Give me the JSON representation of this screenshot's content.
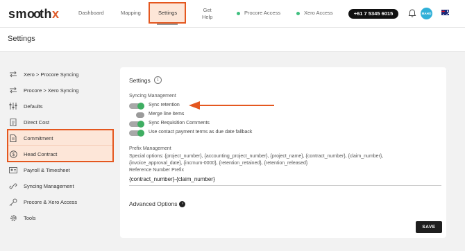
{
  "brand": {
    "logo_prefix": "sm",
    "logo_mid": "◯◯",
    "logo_th": "th",
    "logo_x": "x"
  },
  "nav": {
    "dashboard": "Dashboard",
    "mapping": "Mapping",
    "settings": "Settings",
    "help_line1": "Get",
    "help_line2": "Help",
    "procore_access": "Procore Access",
    "xero_access": "Xero Access",
    "phone": "+61 7 5345 6015",
    "avatar_text": "MAHO",
    "status_color": "#3fbf7f",
    "accent": "#e4571f"
  },
  "page": {
    "title": "Settings"
  },
  "sidebar": {
    "items": [
      {
        "label": "Xero > Procore Syncing",
        "icon": "arrows-swap-icon"
      },
      {
        "label": "Procore > Xero Syncing",
        "icon": "arrows-swap-icon"
      },
      {
        "label": "Defaults",
        "icon": "sliders-icon"
      },
      {
        "label": "Direct Cost",
        "icon": "document-icon"
      },
      {
        "label": "Commitment",
        "icon": "file-icon"
      },
      {
        "label": "Head Contract",
        "icon": "dollar-icon"
      },
      {
        "label": "Payroll & Timesheet",
        "icon": "id-card-icon"
      },
      {
        "label": "Syncing Management",
        "icon": "link-icon"
      },
      {
        "label": "Procore & Xero Access",
        "icon": "key-icon"
      },
      {
        "label": "Tools",
        "icon": "gear-icon"
      }
    ]
  },
  "settings": {
    "title": "Settings",
    "info_glyph": "i",
    "syncing_heading": "Syncing Management",
    "toggles": [
      {
        "label": "Sync retention",
        "on": true
      },
      {
        "label": "Merge line items",
        "on": false
      },
      {
        "label": "Sync Requisition Comments",
        "on": true
      },
      {
        "label": "Use contact payment terms as due date fallback",
        "on": true
      }
    ],
    "prefix_heading": "Prefix Management",
    "special_options": "Special options: {project_number}, {accounting_project_number}, {project_name}, {contract_number}, {claim_number}, {invoice_approval_date}, {incmum-0000}, {retention_retained}, {retention_released}",
    "ref_prefix_label": "Reference Number Prefix",
    "ref_prefix_value": "{contract_number}-{claim_number}",
    "advanced_label": "Advanced Options",
    "save_label": "SAVE"
  }
}
